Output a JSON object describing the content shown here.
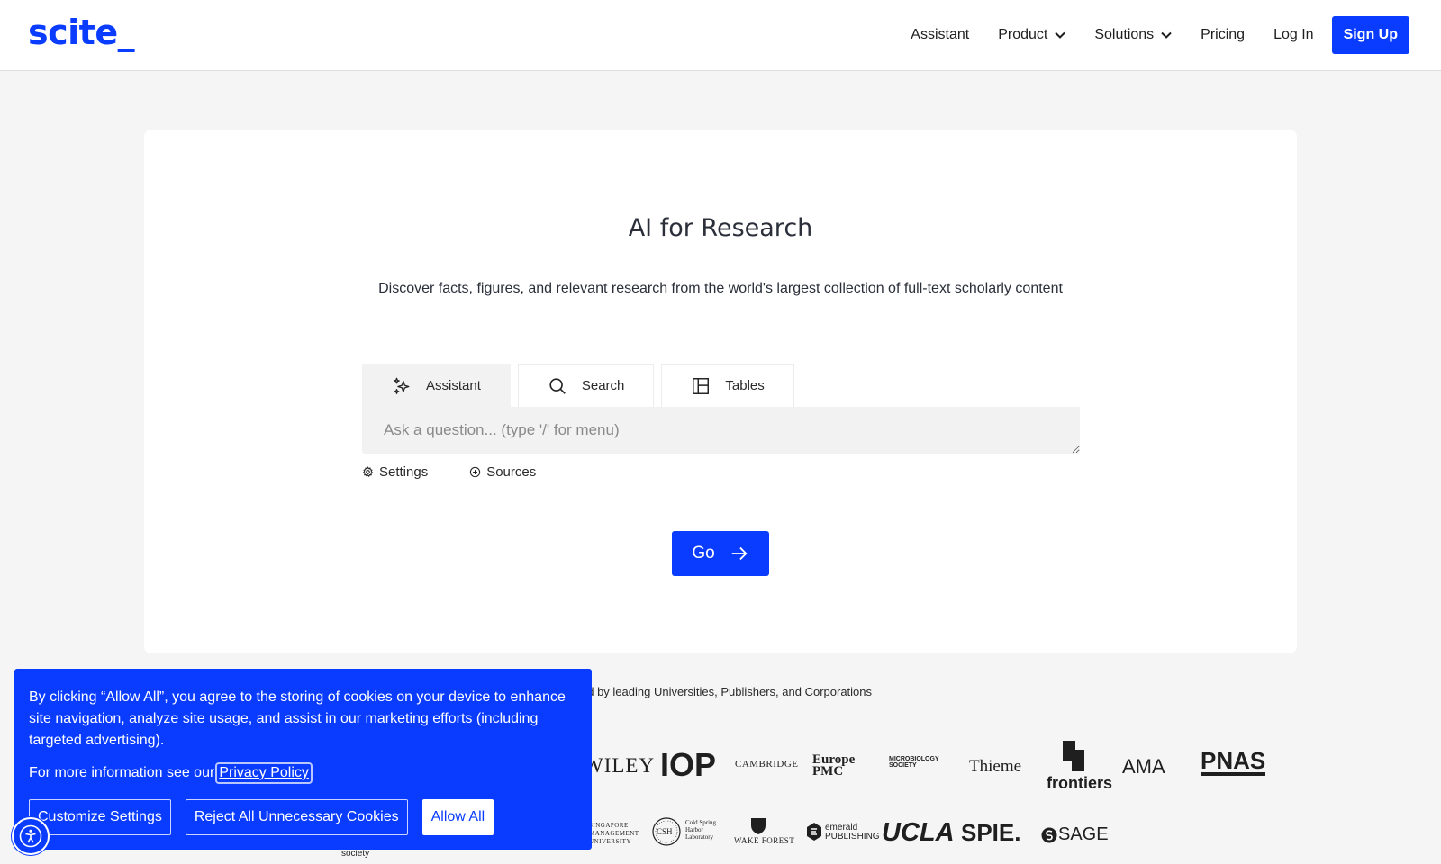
{
  "header": {
    "logo": "scite_",
    "nav": {
      "assistant": "Assistant",
      "product": "Product",
      "solutions": "Solutions",
      "pricing": "Pricing",
      "login": "Log In",
      "signup": "Sign Up"
    }
  },
  "hero": {
    "title": "AI for Research",
    "subtitle": "Discover facts, figures, and relevant research from the world's largest collection of full-text scholarly content"
  },
  "tabs": [
    {
      "label": "Assistant",
      "icon": "sparkles-icon",
      "active": true
    },
    {
      "label": "Search",
      "icon": "search-icon",
      "active": false
    },
    {
      "label": "Tables",
      "icon": "table-icon",
      "active": false
    }
  ],
  "question": {
    "placeholder": "Ask a question... (type '/' for menu)",
    "value": ""
  },
  "options": {
    "settings": "Settings",
    "sources": "Sources"
  },
  "go_label": "Go",
  "trusted_text": "ed by leading Universities, Publishers, and Corporations",
  "publishers_row1": [
    "WILEY",
    "IOP",
    "CAMBRIDGE",
    "Europe PMC",
    "MICROBIOLOGY SOCIETY",
    "Thieme",
    "frontiers",
    "AMA",
    "PNAS"
  ],
  "publishers_row2": [
    "SINGAPORE MANAGEMENT UNIVERSITY",
    "CSH",
    "Cold Spring Harbor Laboratory",
    "WAKE FOREST",
    "emerald PUBLISHING",
    "UCLA",
    "SPIE.",
    "SAGE"
  ],
  "society_text": "society",
  "cookie": {
    "text": "By clicking “Allow All”, you agree to the storing of cookies on your device to enhance site navigation, analyze site usage, and assist in our marketing efforts (including targeted advertising).",
    "more_prefix": "For more information see our",
    "privacy_link": "Privacy Policy",
    "customize": "Customize Settings",
    "reject": "Reject All Unnecessary Cookies",
    "allow": "Allow All"
  },
  "colors": {
    "brand": "#0a3cff",
    "background": "#f5f5f5",
    "card": "#ffffff"
  }
}
